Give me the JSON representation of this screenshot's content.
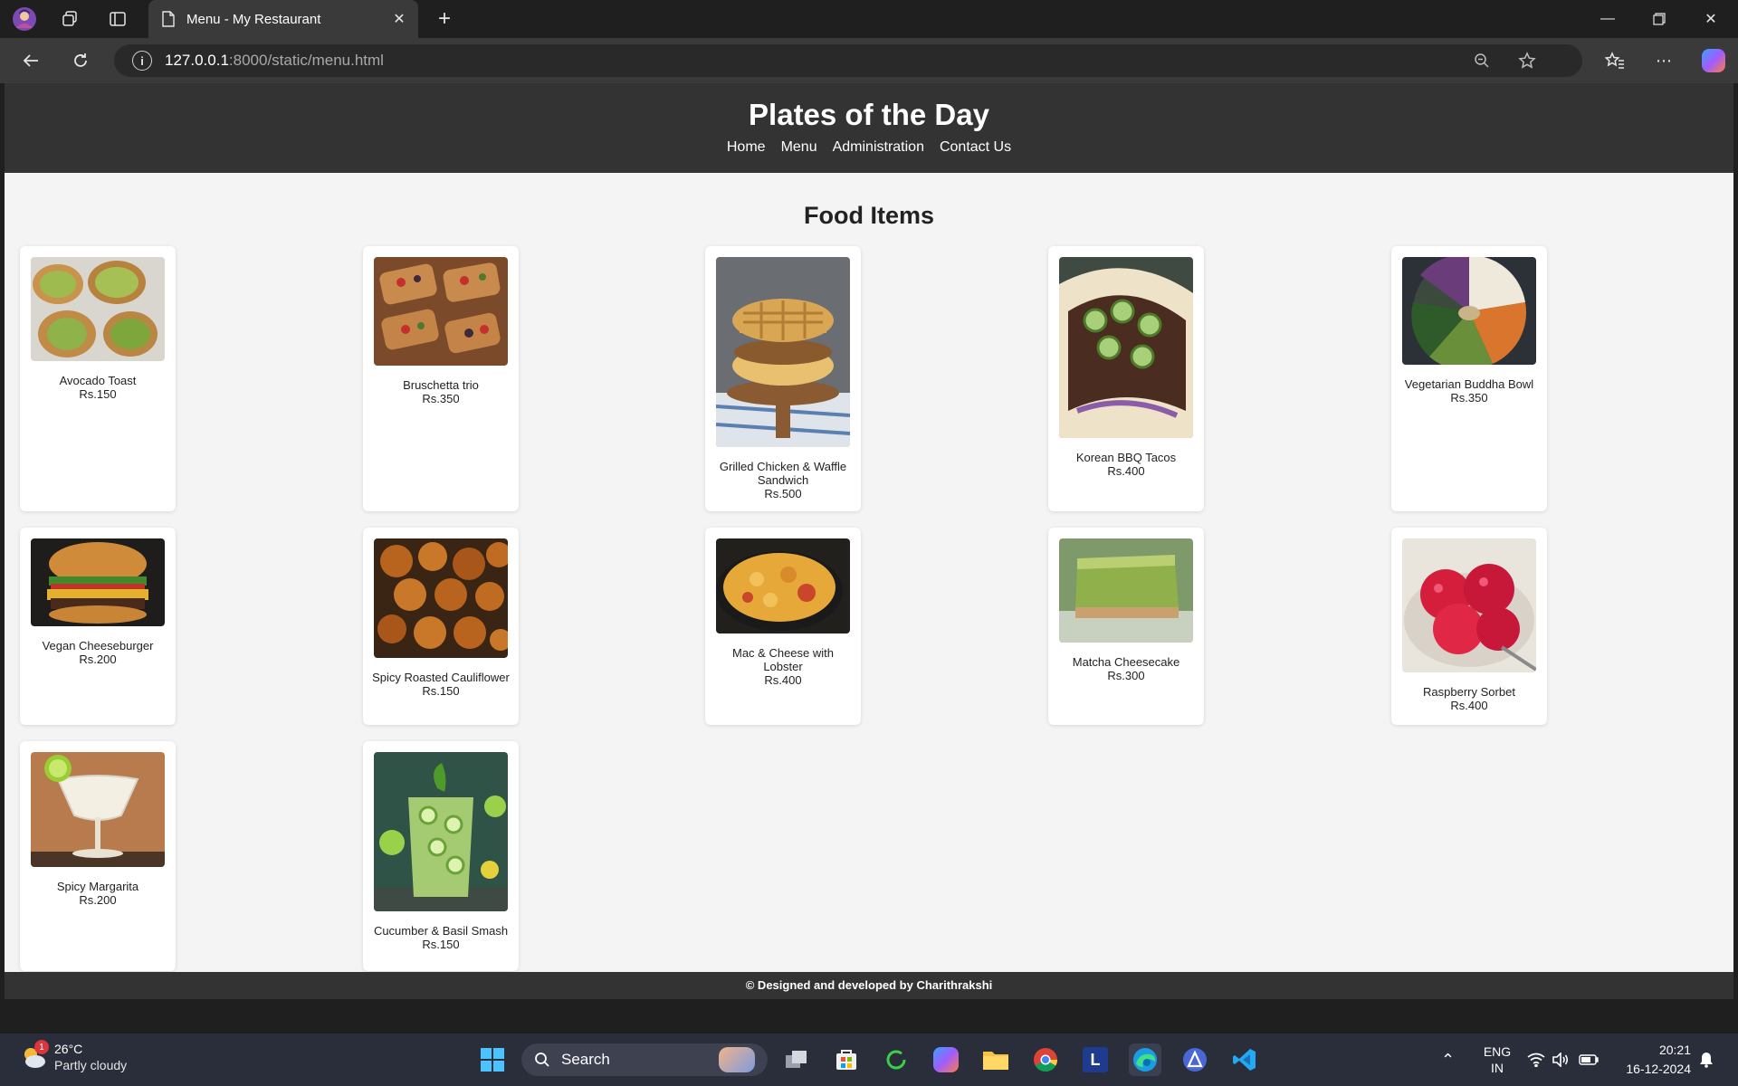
{
  "browser": {
    "tab_title": "Menu - My Restaurant",
    "url_host": "127.0.0.1",
    "url_rest": ":8000/static/menu.html"
  },
  "site": {
    "title": "Plates of the Day",
    "nav": [
      "Home",
      "Menu",
      "Administration",
      "Contact Us"
    ],
    "section_title": "Food Items",
    "footer": "© Designed and developed by Charithrakshi"
  },
  "food_items": [
    {
      "name": "Avocado Toast",
      "price": "Rs.150"
    },
    {
      "name": "Bruschetta trio",
      "price": "Rs.350"
    },
    {
      "name": "Grilled Chicken & Waffle Sandwich",
      "price": "Rs.500"
    },
    {
      "name": "Korean BBQ Tacos",
      "price": "Rs.400"
    },
    {
      "name": "Vegetarian Buddha Bowl",
      "price": "Rs.350"
    },
    {
      "name": "Vegan Cheeseburger",
      "price": "Rs.200"
    },
    {
      "name": "Spicy Roasted Cauliflower",
      "price": "Rs.150"
    },
    {
      "name": "Mac & Cheese with Lobster",
      "price": "Rs.400"
    },
    {
      "name": "Matcha Cheesecake",
      "price": "Rs.300"
    },
    {
      "name": "Raspberry Sorbet",
      "price": "Rs.400"
    },
    {
      "name": "Spicy Margarita",
      "price": "Rs.200"
    },
    {
      "name": "Cucumber & Basil Smash",
      "price": "Rs.150"
    }
  ],
  "taskbar": {
    "weather_temp": "26°C",
    "weather_cond": "Partly cloudy",
    "weather_badge": "1",
    "search_label": "Search",
    "lang_top": "ENG",
    "lang_bottom": "IN",
    "time": "20:21",
    "date": "16-12-2024"
  }
}
